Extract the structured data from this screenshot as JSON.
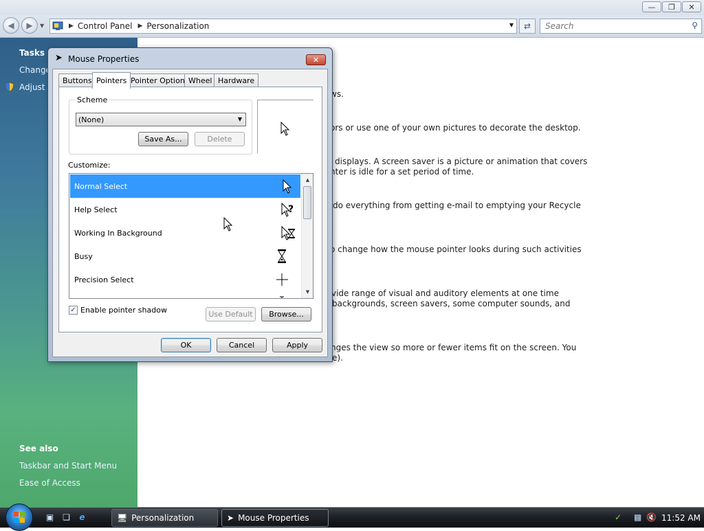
{
  "explorer": {
    "breadcrumb": [
      "Control Panel",
      "Personalization"
    ],
    "search_placeholder": "Search"
  },
  "taskpane": {
    "tasks_heading": "Tasks",
    "tasks": [
      "Change",
      "Adjust f"
    ],
    "see_also_heading": "See also",
    "see_also": [
      "Taskbar and Start Menu",
      "Ease of Access"
    ]
  },
  "content": {
    "lines": [
      "ws.",
      "ors or use one of your own pictures to decorate the desktop.",
      "displays. A screen saver is a picture or animation that covers",
      "nter is idle for a set period of time.",
      "do everything from getting e-mail to emptying your Recycle",
      "o change how the mouse pointer looks during such activities",
      "vide range of visual and auditory elements at one time",
      "backgrounds, screen savers, some computer sounds, and",
      "nges the view so more or fewer items fit on the screen. You",
      "e)."
    ]
  },
  "dialog": {
    "title": "Mouse Properties",
    "tabs": [
      "Buttons",
      "Pointers",
      "Pointer Options",
      "Wheel",
      "Hardware"
    ],
    "active_tab": "Pointers",
    "scheme_label": "Scheme",
    "scheme_value": "(None)",
    "save_as": "Save As...",
    "delete": "Delete",
    "customize_label": "Customize:",
    "cursors": [
      {
        "name": "Normal Select",
        "icon": "arrow-cursor-icon",
        "selected": true
      },
      {
        "name": "Help Select",
        "icon": "help-cursor-icon",
        "selected": false
      },
      {
        "name": "Working In Background",
        "icon": "working-cursor-icon",
        "selected": false
      },
      {
        "name": "Busy",
        "icon": "hourglass-cursor-icon",
        "selected": false
      },
      {
        "name": "Precision Select",
        "icon": "crosshair-cursor-icon",
        "selected": false
      },
      {
        "name": "",
        "icon": "text-cursor-icon",
        "selected": false
      }
    ],
    "enable_shadow_label": "Enable pointer shadow",
    "enable_shadow_checked": true,
    "use_default": "Use Default",
    "browse": "Browse...",
    "ok": "OK",
    "cancel": "Cancel",
    "apply": "Apply"
  },
  "taskbar": {
    "buttons": [
      "Personalization",
      "Mouse Properties"
    ],
    "clock": "11:52 AM"
  }
}
